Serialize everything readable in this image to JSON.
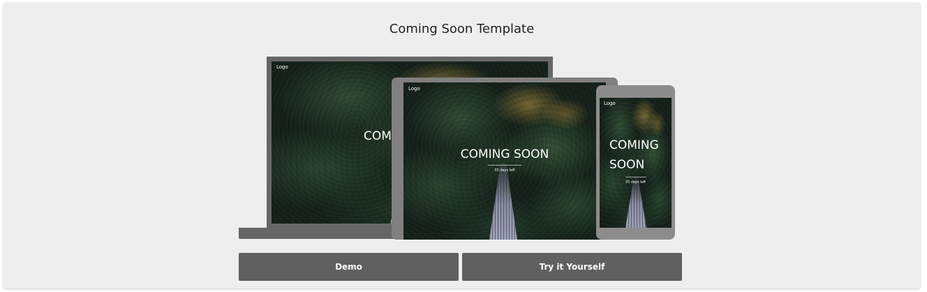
{
  "page": {
    "title": "Coming Soon Template"
  },
  "preview": {
    "logo_label": "Logo",
    "headline": "COMING SOON",
    "headline_line1": "COMING",
    "headline_line2": "SOON",
    "headline_partial": "COM",
    "countdown": "35 days left"
  },
  "actions": {
    "demo_label": "Demo",
    "try_label": "Try it Yourself"
  },
  "colors": {
    "card_background": "#eeeeee",
    "button_background": "#606060",
    "device_frame": "#666666"
  }
}
